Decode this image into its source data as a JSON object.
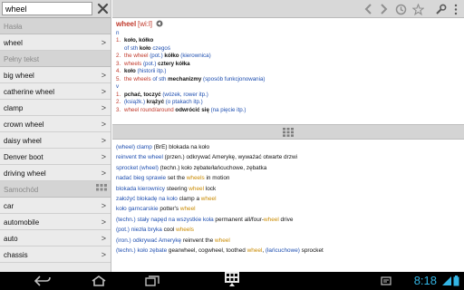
{
  "search": {
    "value": "wheel"
  },
  "sidebar": {
    "section_headwords": "Hasła",
    "headword_item": "wheel",
    "section_fulltext": "Pełny tekst",
    "fulltext_items": [
      "big wheel",
      "catherine wheel",
      "clamp",
      "crown wheel",
      "daisy wheel",
      "Denver boot",
      "driving wheel"
    ],
    "section_category": "Samochód",
    "category_items": [
      "car",
      "automobile",
      "auto",
      "chassis"
    ]
  },
  "entry": {
    "headword": "wheel",
    "pron": "[wi:l]",
    "pos_n": "n",
    "pos_v": "v",
    "senses_n": [
      {
        "n": "1.",
        "parts": [
          {
            "t": "koło, kółko",
            "c": "bold"
          }
        ]
      },
      {
        "n": "",
        "parts": [
          {
            "t": "of sth ",
            "c": "blue"
          },
          {
            "t": "koło ",
            "c": "bold"
          },
          {
            "t": "czegoś",
            "c": "blue"
          }
        ]
      },
      {
        "n": "2.",
        "parts": [
          {
            "t": "the wheel ",
            "c": "red"
          },
          {
            "t": "(pot.) ",
            "c": "blue"
          },
          {
            "t": "kółko ",
            "c": "bold"
          },
          {
            "t": "(kierownica)",
            "c": "blue"
          }
        ]
      },
      {
        "n": "3.",
        "parts": [
          {
            "t": "wheels ",
            "c": "red"
          },
          {
            "t": "(pot.) ",
            "c": "blue"
          },
          {
            "t": "cztery kółka",
            "c": "bold"
          }
        ]
      },
      {
        "n": "4.",
        "parts": [
          {
            "t": "koło ",
            "c": "bold"
          },
          {
            "t": "(historii itp.)",
            "c": "blue"
          }
        ]
      },
      {
        "n": "5.",
        "parts": [
          {
            "t": "the wheels ",
            "c": "red"
          },
          {
            "t": "of sth ",
            "c": "blue"
          },
          {
            "t": "mechanizmy ",
            "c": "bold"
          },
          {
            "t": "(sposób funkcjonowania)",
            "c": "blue"
          }
        ]
      }
    ],
    "senses_v": [
      {
        "n": "1.",
        "parts": [
          {
            "t": "pchać, toczyć ",
            "c": "bold"
          },
          {
            "t": "(wózek, rower itp.)",
            "c": "blue"
          }
        ]
      },
      {
        "n": "2.",
        "parts": [
          {
            "t": "(książk.) ",
            "c": "blue"
          },
          {
            "t": "krążyć ",
            "c": "bold"
          },
          {
            "t": "(o ptakach itp.)",
            "c": "blue"
          }
        ]
      },
      {
        "n": "3.",
        "parts": [
          {
            "t": "wheel round/around ",
            "c": "red"
          },
          {
            "t": "odwrócić się ",
            "c": "bold"
          },
          {
            "t": "(na pięcie itp.)",
            "c": "blue"
          }
        ]
      }
    ]
  },
  "phrases": [
    [
      {
        "t": "(wheel) clamp ",
        "c": "ph"
      },
      {
        "t": "(BrE) blokada na koło",
        "c": ""
      }
    ],
    [
      {
        "t": "reinvent the wheel ",
        "c": "ph"
      },
      {
        "t": "(przen.) odkrywać Amerykę, wyważać otwarte drzwi",
        "c": ""
      }
    ],
    [
      {
        "t": "sprocket (wheel) ",
        "c": "ph"
      },
      {
        "t": "(techn.) koło zębate/łańcuchowe, zębatka",
        "c": ""
      }
    ],
    [
      {
        "t": "nadać bieg sprawie ",
        "c": "ph"
      },
      {
        "t": "set the ",
        "c": ""
      },
      {
        "t": "wheels",
        "c": "hl"
      },
      {
        "t": " in motion",
        "c": ""
      }
    ],
    [
      {
        "t": "blokada kierownicy ",
        "c": "ph"
      },
      {
        "t": "steering ",
        "c": ""
      },
      {
        "t": "wheel",
        "c": "hl"
      },
      {
        "t": " lock",
        "c": ""
      }
    ],
    [
      {
        "t": "założyć blokadę na koło ",
        "c": "ph"
      },
      {
        "t": "clamp a ",
        "c": ""
      },
      {
        "t": "wheel",
        "c": "hl"
      }
    ],
    [
      {
        "t": "koło garncarskie ",
        "c": "ph"
      },
      {
        "t": "potter's ",
        "c": ""
      },
      {
        "t": "wheel",
        "c": "hl"
      }
    ],
    [
      {
        "t": "(techn.) stały napęd na wszystkie koła ",
        "c": "ph"
      },
      {
        "t": "permanent all/four-",
        "c": ""
      },
      {
        "t": "wheel",
        "c": "hl"
      },
      {
        "t": " drive",
        "c": ""
      }
    ],
    [
      {
        "t": "(pot.) niezła bryka ",
        "c": "ph"
      },
      {
        "t": "cool ",
        "c": ""
      },
      {
        "t": "wheels",
        "c": "hl"
      }
    ],
    [
      {
        "t": "(iron.) odkrywać Amerykę ",
        "c": "ph"
      },
      {
        "t": "reinvent the ",
        "c": ""
      },
      {
        "t": "wheel",
        "c": "hl"
      }
    ],
    [
      {
        "t": "(techn.) koło zębate ",
        "c": "ph"
      },
      {
        "t": "gearwheel, cogwheel, toothed ",
        "c": ""
      },
      {
        "t": "wheel",
        "c": "hl"
      },
      {
        "t": ", ",
        "c": ""
      },
      {
        "t": "(łańcuchowe)",
        "c": "ph"
      },
      {
        "t": " sprocket",
        "c": ""
      }
    ]
  ],
  "status": {
    "time": "8:18"
  },
  "colors": {
    "accent": "#33b5e5",
    "headword": "#c0392b",
    "gloss": "#1f4fb0",
    "highlight": "#c98a00"
  },
  "icons": [
    "back-icon",
    "forward-icon",
    "history-icon",
    "star-icon",
    "settings-icon",
    "overflow-icon",
    "speaker-icon",
    "grid-icon"
  ]
}
